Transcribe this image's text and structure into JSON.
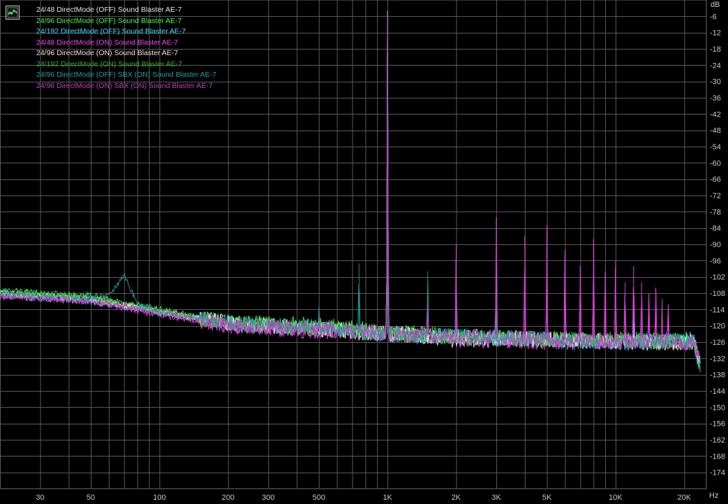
{
  "chart_data": {
    "type": "line",
    "title": "",
    "xlabel": "Hz",
    "ylabel": "dB",
    "x_scale": "log",
    "xlim": [
      20,
      25000
    ],
    "ylim": [
      -180,
      0
    ],
    "grid": true,
    "legend_position": "top-left",
    "x_ticks": [
      {
        "value": 30,
        "label": "30"
      },
      {
        "value": 50,
        "label": "50"
      },
      {
        "value": 100,
        "label": "100"
      },
      {
        "value": 200,
        "label": "200"
      },
      {
        "value": 300,
        "label": "300"
      },
      {
        "value": 500,
        "label": "500"
      },
      {
        "value": 1000,
        "label": "1K"
      },
      {
        "value": 2000,
        "label": "2K"
      },
      {
        "value": 3000,
        "label": "3K"
      },
      {
        "value": 5000,
        "label": "5K"
      },
      {
        "value": 10000,
        "label": "10K"
      },
      {
        "value": 20000,
        "label": "20K"
      }
    ],
    "y_ticks": [
      -6,
      -12,
      -18,
      -24,
      -30,
      -36,
      -42,
      -48,
      -54,
      -60,
      -66,
      -72,
      -78,
      -84,
      -90,
      -96,
      -102,
      -108,
      -114,
      -120,
      -126,
      -132,
      -138,
      -144,
      -150,
      -156,
      -162,
      -168,
      -174
    ],
    "series": [
      {
        "name": "24/48 DirectMode (OFF) Sound Blaster AE-7",
        "color": "#e8e8e8",
        "noise": [
          [
            20,
            -108
          ],
          [
            50,
            -110
          ],
          [
            100,
            -115
          ],
          [
            200,
            -119
          ],
          [
            500,
            -121
          ],
          [
            1000,
            -123
          ],
          [
            2000,
            -125
          ],
          [
            5000,
            -125
          ],
          [
            10000,
            -126
          ],
          [
            22000,
            -126
          ],
          [
            23500,
            -134
          ]
        ],
        "peaks": [
          [
            1000,
            -4
          ]
        ]
      },
      {
        "name": "24/96 DirectMode (OFF) Sound Blaster AE-7",
        "color": "#40ff40",
        "noise": [
          [
            20,
            -107
          ],
          [
            50,
            -109
          ],
          [
            100,
            -114
          ],
          [
            200,
            -119
          ],
          [
            500,
            -120
          ],
          [
            1000,
            -122
          ],
          [
            2000,
            -124
          ],
          [
            5000,
            -125
          ],
          [
            10000,
            -125
          ],
          [
            22000,
            -126
          ],
          [
            23500,
            -134
          ]
        ],
        "peaks": [
          [
            1000,
            -5
          ]
        ]
      },
      {
        "name": "24/192 DirectMode (OFF) Sound Blaster AE-7",
        "color": "#40e0ff",
        "noise": [
          [
            20,
            -109
          ],
          [
            50,
            -111
          ],
          [
            100,
            -115
          ],
          [
            200,
            -119
          ],
          [
            500,
            -121
          ],
          [
            1000,
            -123
          ],
          [
            2000,
            -124
          ],
          [
            5000,
            -125
          ],
          [
            10000,
            -126
          ],
          [
            22000,
            -125
          ],
          [
            23500,
            -135
          ]
        ],
        "peaks": [
          [
            1000,
            -5
          ],
          [
            12000,
            -114
          ]
        ]
      },
      {
        "name": "24/48 DirectMode (ON) Sound Blaster AE-7",
        "color": "#ff40ff",
        "noise": [
          [
            20,
            -109
          ],
          [
            50,
            -111
          ],
          [
            100,
            -116
          ],
          [
            200,
            -120
          ],
          [
            500,
            -122
          ],
          [
            1000,
            -123
          ],
          [
            2000,
            -125
          ],
          [
            5000,
            -126
          ],
          [
            10000,
            -126
          ],
          [
            22000,
            -126
          ],
          [
            23500,
            -133
          ]
        ],
        "peaks": [
          [
            1000,
            -4
          ],
          [
            2000,
            -90
          ],
          [
            3000,
            -80
          ],
          [
            4000,
            -87
          ],
          [
            5000,
            -83
          ],
          [
            6000,
            -92
          ],
          [
            7000,
            -98
          ],
          [
            8000,
            -88
          ],
          [
            9000,
            -100
          ],
          [
            10000,
            -96
          ],
          [
            11000,
            -104
          ],
          [
            12000,
            -98
          ],
          [
            13000,
            -104
          ],
          [
            14000,
            -108
          ],
          [
            15000,
            -106
          ],
          [
            17000,
            -112
          ]
        ]
      },
      {
        "name": "24/96 DirectMode (ON) Sound Blaster AE-7",
        "color": "#ffe0e0",
        "noise": [
          [
            20,
            -108
          ],
          [
            50,
            -110
          ],
          [
            100,
            -115
          ],
          [
            200,
            -119
          ],
          [
            500,
            -121
          ],
          [
            1000,
            -123
          ],
          [
            2000,
            -124
          ],
          [
            5000,
            -125
          ],
          [
            10000,
            -126
          ],
          [
            22000,
            -126
          ],
          [
            23500,
            -133
          ]
        ],
        "peaks": [
          [
            1000,
            -5
          ],
          [
            3000,
            -98
          ]
        ]
      },
      {
        "name": "24/192 DirectMode (ON) Sound Blaster AE-7",
        "color": "#30b030",
        "noise": [
          [
            20,
            -108
          ],
          [
            50,
            -110
          ],
          [
            100,
            -115
          ],
          [
            200,
            -119
          ],
          [
            500,
            -121
          ],
          [
            1000,
            -123
          ],
          [
            2000,
            -124
          ],
          [
            5000,
            -125
          ],
          [
            10000,
            -125
          ],
          [
            22000,
            -126
          ],
          [
            23500,
            -134
          ]
        ],
        "peaks": [
          [
            1000,
            -6
          ]
        ]
      },
      {
        "name": "24/96 DirectMode (OFF) SBX (ON) Sound Blaster AE-7",
        "color": "#20a0a0",
        "noise": [
          [
            20,
            -108
          ],
          [
            40,
            -110
          ],
          [
            60,
            -109
          ],
          [
            70,
            -101
          ],
          [
            80,
            -112
          ],
          [
            100,
            -115
          ],
          [
            200,
            -119
          ],
          [
            500,
            -121
          ],
          [
            1000,
            -123
          ],
          [
            2000,
            -124
          ],
          [
            5000,
            -125
          ],
          [
            10000,
            -126
          ],
          [
            22000,
            -126
          ],
          [
            23500,
            -136
          ]
        ],
        "peaks": [
          [
            500,
            -113
          ],
          [
            750,
            -97
          ],
          [
            1000,
            -5
          ],
          [
            1500,
            -100
          ],
          [
            2000,
            -104
          ],
          [
            3000,
            -110
          ]
        ]
      },
      {
        "name": "24/96 DirectMode (ON) SBX (ON) Sound Blaster AE-7",
        "color": "#c040c0",
        "noise": [
          [
            20,
            -109
          ],
          [
            50,
            -111
          ],
          [
            100,
            -115
          ],
          [
            200,
            -120
          ],
          [
            500,
            -121
          ],
          [
            1000,
            -123
          ],
          [
            2000,
            -124
          ],
          [
            5000,
            -125
          ],
          [
            10000,
            -126
          ],
          [
            22000,
            -126
          ],
          [
            23500,
            -134
          ]
        ],
        "peaks": [
          [
            1000,
            -5
          ],
          [
            1500,
            -112
          ],
          [
            2000,
            -94
          ],
          [
            3000,
            -82
          ],
          [
            4000,
            -100
          ],
          [
            5000,
            -90
          ],
          [
            7000,
            -98
          ],
          [
            8000,
            -90
          ],
          [
            10000,
            -96
          ],
          [
            11000,
            -104
          ],
          [
            13000,
            -108
          ],
          [
            16000,
            -110
          ]
        ]
      }
    ]
  }
}
